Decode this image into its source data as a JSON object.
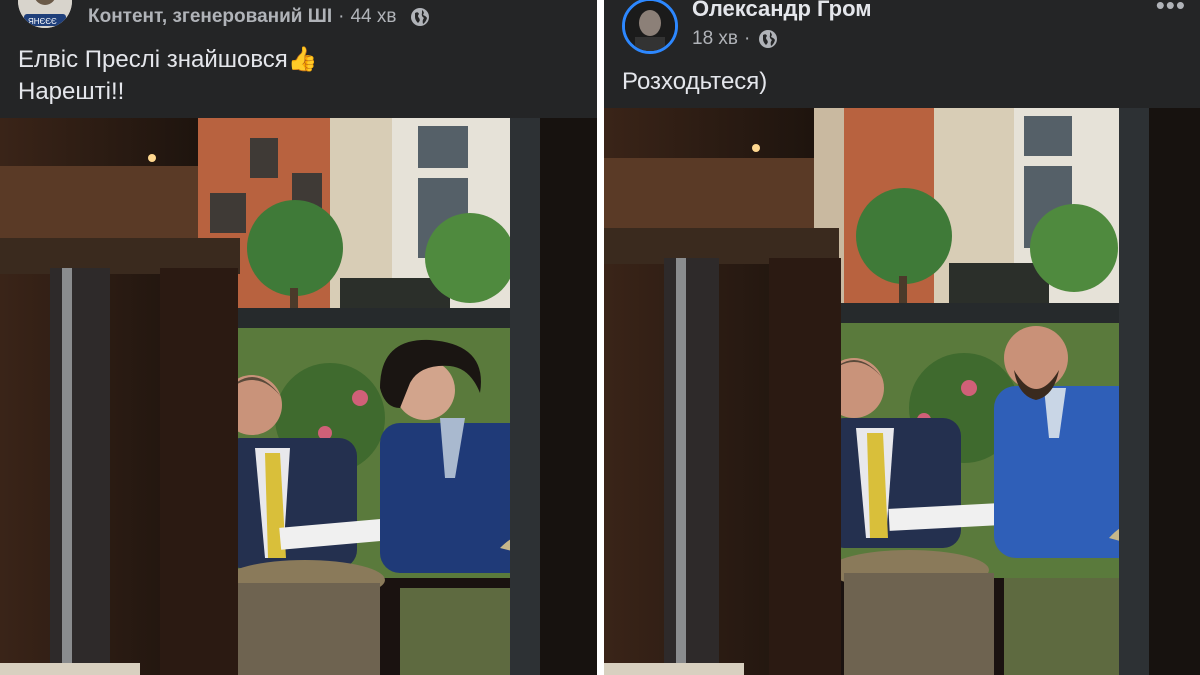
{
  "left_post": {
    "author_line": "Контент, згенерований ШІ",
    "time": "44 хв",
    "separator": "·",
    "avatar_icon": "profile-avatar-icon",
    "audience_icon": "globe-icon",
    "caption_line1": "Елвіс Преслі знайшовся👍",
    "caption_line2": "Нарешті!!",
    "photo": "restaurant-window-photo"
  },
  "right_post": {
    "author": "Олександр Гром",
    "time": "18 хв",
    "separator": "·",
    "avatar_icon": "profile-avatar-icon",
    "audience_icon": "globe-icon",
    "more_label": "•••",
    "caption": "Розходьтеся)",
    "photo": "restaurant-window-photo"
  },
  "colors": {
    "background": "#242526",
    "text_primary": "#e4e6eb",
    "text_secondary": "#b0b3b8",
    "avatar_ring": "#2d88ff",
    "divider": "#ffffff"
  }
}
